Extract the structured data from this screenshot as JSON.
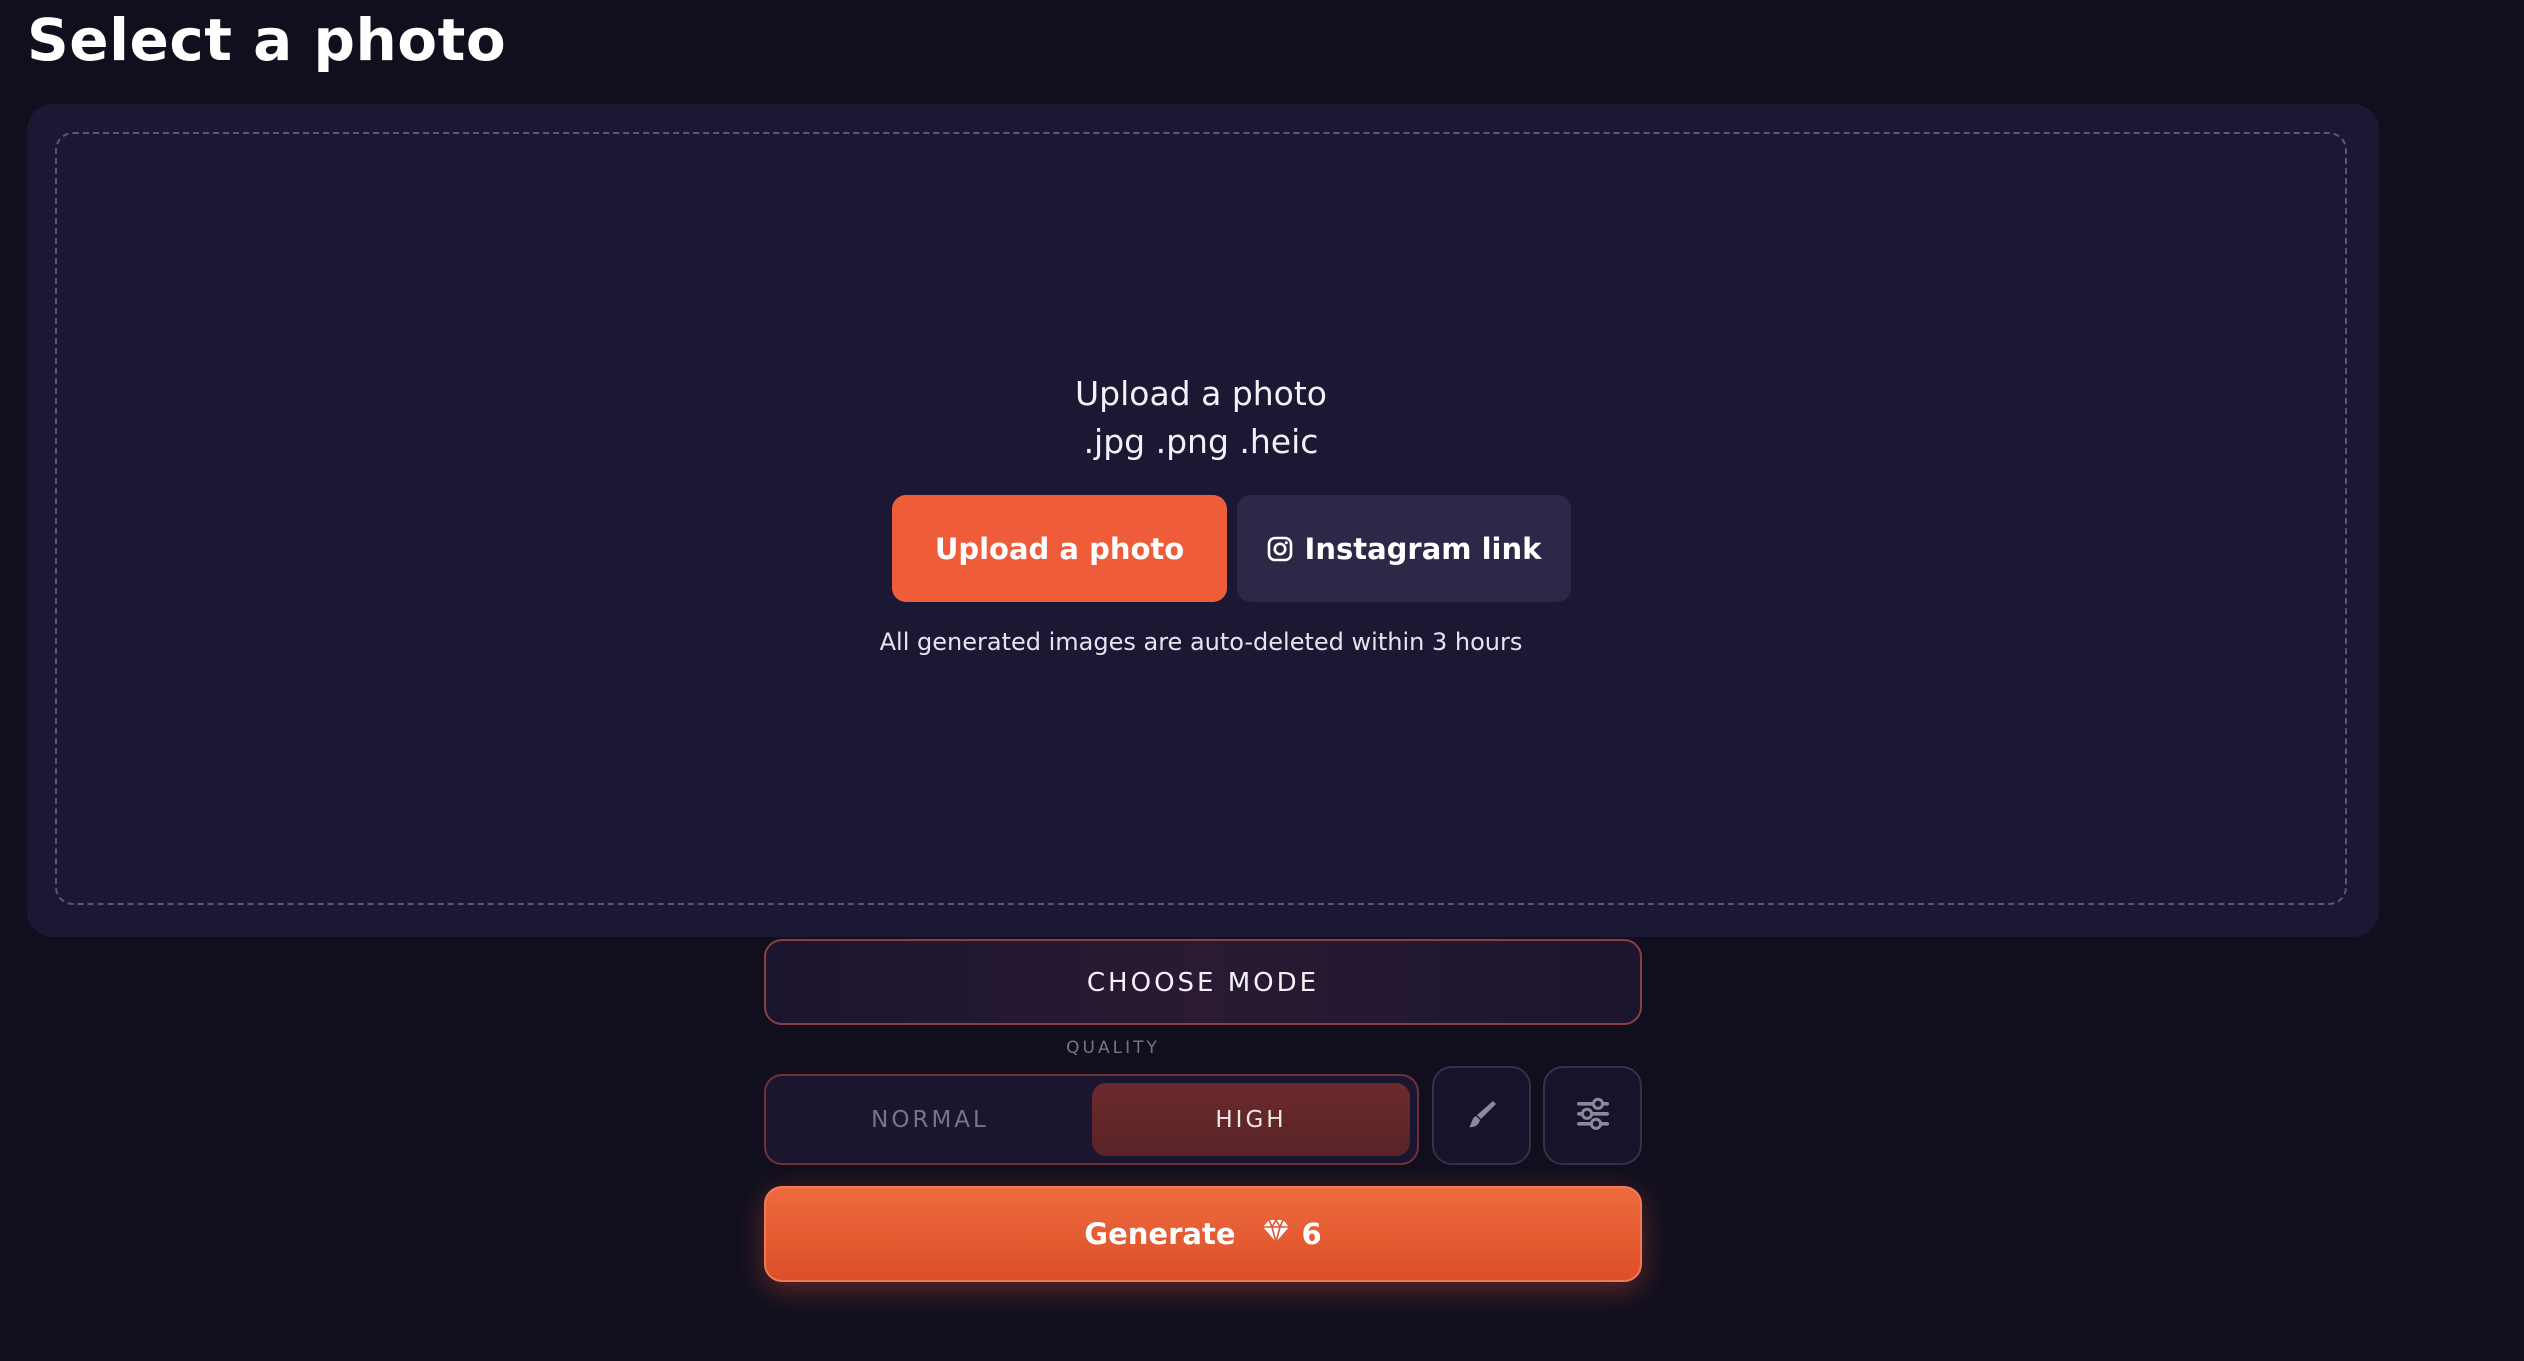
{
  "page": {
    "title": "Select a photo"
  },
  "uploader": {
    "heading": "Upload a photo",
    "formats": ".jpg .png .heic",
    "upload_button_label": "Upload a photo",
    "instagram_button_label": "Instagram link",
    "note": "All generated images are auto-deleted within 3 hours"
  },
  "mode": {
    "choose_label": "CHOOSE MODE"
  },
  "quality": {
    "label": "QUALITY",
    "options": [
      "NORMAL",
      "HIGH"
    ],
    "selected": "HIGH"
  },
  "tools": {
    "brush_icon": "brush-icon",
    "settings_icon": "sliders-icon"
  },
  "generate": {
    "label": "Generate",
    "cost": "6",
    "cost_icon": "gem-icon"
  },
  "colors": {
    "background": "#110f1e",
    "panel": "#1b1833",
    "accent": "#ee5c39",
    "secondary_button": "#2c2948"
  }
}
